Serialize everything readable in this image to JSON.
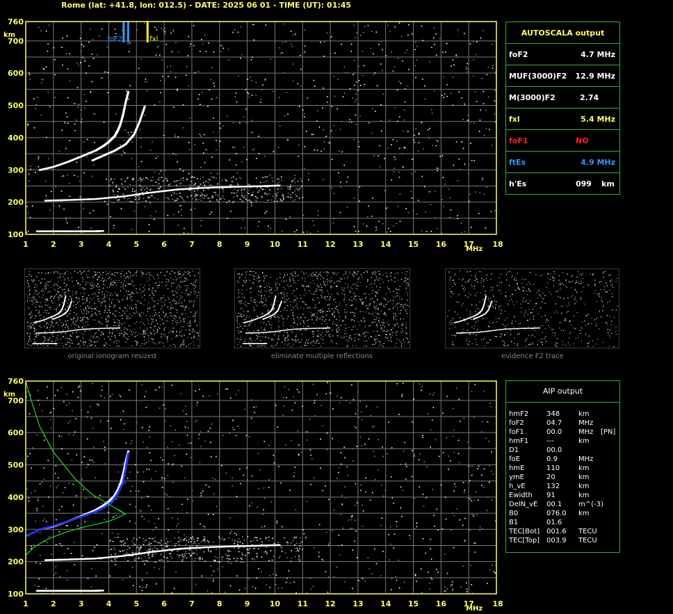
{
  "header": {
    "title": "Rome (lat: +41.8, lon: 012.5) - DATE: 2025 06 01 - TIME (UT): 01:45"
  },
  "colors": {
    "axis": "#ffff66",
    "grid": "#7a7a7a",
    "frame": "#2fb04a",
    "foF2_marker": "#3399ff",
    "fxl_marker": "#ffff00",
    "foF1": "#ff2020",
    "ftEs": "#3399ff",
    "profile": "#22dd22",
    "aip_trace": "#2233ff"
  },
  "top_chart": {
    "markers": {
      "foF2_label": "foF2",
      "fxl_label": "fxl"
    }
  },
  "autoscala": {
    "title": "AUTOSCALA output",
    "rows": [
      {
        "name": "foF2",
        "value": "4.7 MHz",
        "color": "#ffffff"
      },
      {
        "name": "MUF(3000)F2",
        "value": "12.9 MHz",
        "color": "#ffffff"
      },
      {
        "name": "M(3000)F2",
        "value": "2.74",
        "color": "#ffffff"
      },
      {
        "name": "fxl",
        "value": "5.4 MHz",
        "color": "#ffff66"
      },
      {
        "name": "foF1",
        "value": "NO",
        "color": "#ff2020"
      },
      {
        "name": "ftEs",
        "value": "4.9 MHz",
        "color": "#3399ff"
      },
      {
        "name": "h'Es",
        "value": "099",
        "unit": "km",
        "color": "#ffffff"
      }
    ]
  },
  "thumbnails": [
    {
      "caption": "original ionogram resized"
    },
    {
      "caption": "eliminate multiple reflections"
    },
    {
      "caption": "evidence F2 trace"
    }
  ],
  "aip": {
    "title": "AIP output",
    "rows": [
      {
        "name": "hmF2",
        "value": "348",
        "unit": "km",
        "extra": ""
      },
      {
        "name": "foF2",
        "value": "04.7",
        "unit": "MHz",
        "extra": ""
      },
      {
        "name": "foF1",
        "value": "00.0",
        "unit": "MHz",
        "extra": "[PN]"
      },
      {
        "name": "hmF1",
        "value": "---",
        "unit": "km",
        "extra": ""
      },
      {
        "name": "D1",
        "value": "00.0",
        "unit": "",
        "extra": ""
      },
      {
        "name": "foE",
        "value": "0.9",
        "unit": "MHz",
        "extra": ""
      },
      {
        "name": "hmE",
        "value": "110",
        "unit": "km",
        "extra": ""
      },
      {
        "name": "ymE",
        "value": "20",
        "unit": "km",
        "extra": ""
      },
      {
        "name": "h_vE",
        "value": "132",
        "unit": "km",
        "extra": ""
      },
      {
        "name": "Ewidth",
        "value": "91",
        "unit": "km",
        "extra": ""
      },
      {
        "name": "DelN_vE",
        "value": "00.1",
        "unit": "m^(-3)",
        "extra": ""
      },
      {
        "name": "B0",
        "value": "076.0",
        "unit": "km",
        "extra": ""
      },
      {
        "name": "B1",
        "value": "01.6",
        "unit": "",
        "extra": ""
      },
      {
        "name": "TEC[Bot]",
        "value": "001.6",
        "unit": "TECU",
        "extra": ""
      },
      {
        "name": "TEC[Top]",
        "value": "003.9",
        "unit": "TECU",
        "extra": ""
      }
    ]
  },
  "chart_data": [
    {
      "type": "scatter",
      "x_ticks": [
        "1",
        "2",
        "3",
        "4",
        "5",
        "6",
        "7",
        "8",
        "9",
        "10",
        "11",
        "12",
        "13",
        "14",
        "15",
        "16",
        "17",
        "18"
      ],
      "y_ticks": [
        "100",
        "200",
        "300",
        "400",
        "500",
        "600",
        "700",
        "760"
      ],
      "xlabel": "MHz",
      "ylabel": "km",
      "xlim": [
        1,
        18
      ],
      "ylim": [
        100,
        760
      ],
      "grid": true,
      "series": [
        {
          "trace": "F2 o-mode",
          "color": "#ffffff",
          "x": [
            1.5,
            2.0,
            2.5,
            3.0,
            3.5,
            3.8,
            4.0,
            4.2,
            4.3,
            4.4,
            4.5,
            4.6,
            4.7
          ],
          "y": [
            300,
            310,
            325,
            342,
            360,
            375,
            388,
            405,
            420,
            440,
            470,
            510,
            545
          ]
        },
        {
          "trace": "F2 x-mode",
          "color": "#ffffff",
          "x": [
            3.4,
            3.8,
            4.2,
            4.6,
            4.9,
            5.1,
            5.3
          ],
          "y": [
            330,
            345,
            360,
            380,
            410,
            450,
            500
          ]
        },
        {
          "trace": "Es",
          "color": "#ffffff",
          "x": [
            1.7,
            2.5,
            3.5,
            4.5,
            5.5,
            6.5,
            7.5,
            8.5,
            9.5,
            10.2
          ],
          "y": [
            205,
            207,
            210,
            218,
            230,
            240,
            245,
            248,
            250,
            252
          ]
        },
        {
          "trace": "E",
          "color": "#ffffff",
          "x": [
            1.4,
            2.0,
            2.5,
            3.0,
            3.5,
            3.8
          ],
          "y": [
            110,
            110,
            110,
            110,
            110,
            111
          ]
        }
      ],
      "markers": [
        {
          "name": "foF2",
          "x": 4.7
        },
        {
          "name": "fxl",
          "x": 5.4
        }
      ]
    },
    {
      "type": "scatter",
      "x_ticks": [
        "1",
        "2",
        "3",
        "4",
        "5",
        "6",
        "7",
        "8",
        "9",
        "10",
        "11",
        "12",
        "13",
        "14",
        "15",
        "16",
        "17",
        "18"
      ],
      "y_ticks": [
        "100",
        "200",
        "300",
        "400",
        "500",
        "600",
        "700",
        "760"
      ],
      "xlabel": "MHz",
      "ylabel": "km",
      "xlim": [
        1,
        18
      ],
      "ylim": [
        100,
        760
      ],
      "grid": true,
      "series": [
        {
          "trace": "F2 o-mode",
          "color": "#ffffff",
          "x": [
            1.5,
            2.0,
            2.5,
            3.0,
            3.5,
            3.8,
            4.0,
            4.2,
            4.3,
            4.4,
            4.5,
            4.6,
            4.7
          ],
          "y": [
            300,
            310,
            325,
            342,
            360,
            375,
            388,
            405,
            420,
            440,
            470,
            510,
            545
          ]
        },
        {
          "trace": "Es",
          "color": "#ffffff",
          "x": [
            1.7,
            2.5,
            3.5,
            4.5,
            5.5,
            6.5,
            7.5,
            8.5,
            9.5,
            10.2
          ],
          "y": [
            205,
            207,
            210,
            218,
            230,
            240,
            245,
            248,
            250,
            252
          ]
        },
        {
          "trace": "E",
          "color": "#ffffff",
          "x": [
            1.4,
            2.0,
            2.5,
            3.0,
            3.5,
            3.8
          ],
          "y": [
            110,
            110,
            110,
            110,
            110,
            111
          ]
        },
        {
          "trace": "AIP trace",
          "color": "#2233ff",
          "x": [
            1.0,
            1.5,
            2.0,
            2.5,
            3.0,
            3.5,
            3.8,
            4.1,
            4.3,
            4.5,
            4.6,
            4.7
          ],
          "y": [
            280,
            300,
            312,
            325,
            340,
            355,
            368,
            385,
            410,
            445,
            490,
            540
          ]
        },
        {
          "trace": "AIP profile",
          "color": "#22dd22",
          "x": [
            1.0,
            1.3,
            1.8,
            2.4,
            3.0,
            3.5,
            4.0,
            4.3,
            4.6,
            4.0,
            3.4,
            2.8,
            2.0,
            1.5,
            1.2,
            1.0
          ],
          "y": [
            220,
            245,
            270,
            290,
            305,
            315,
            325,
            335,
            348,
            378,
            408,
            455,
            540,
            620,
            700,
            760
          ]
        }
      ]
    }
  ]
}
